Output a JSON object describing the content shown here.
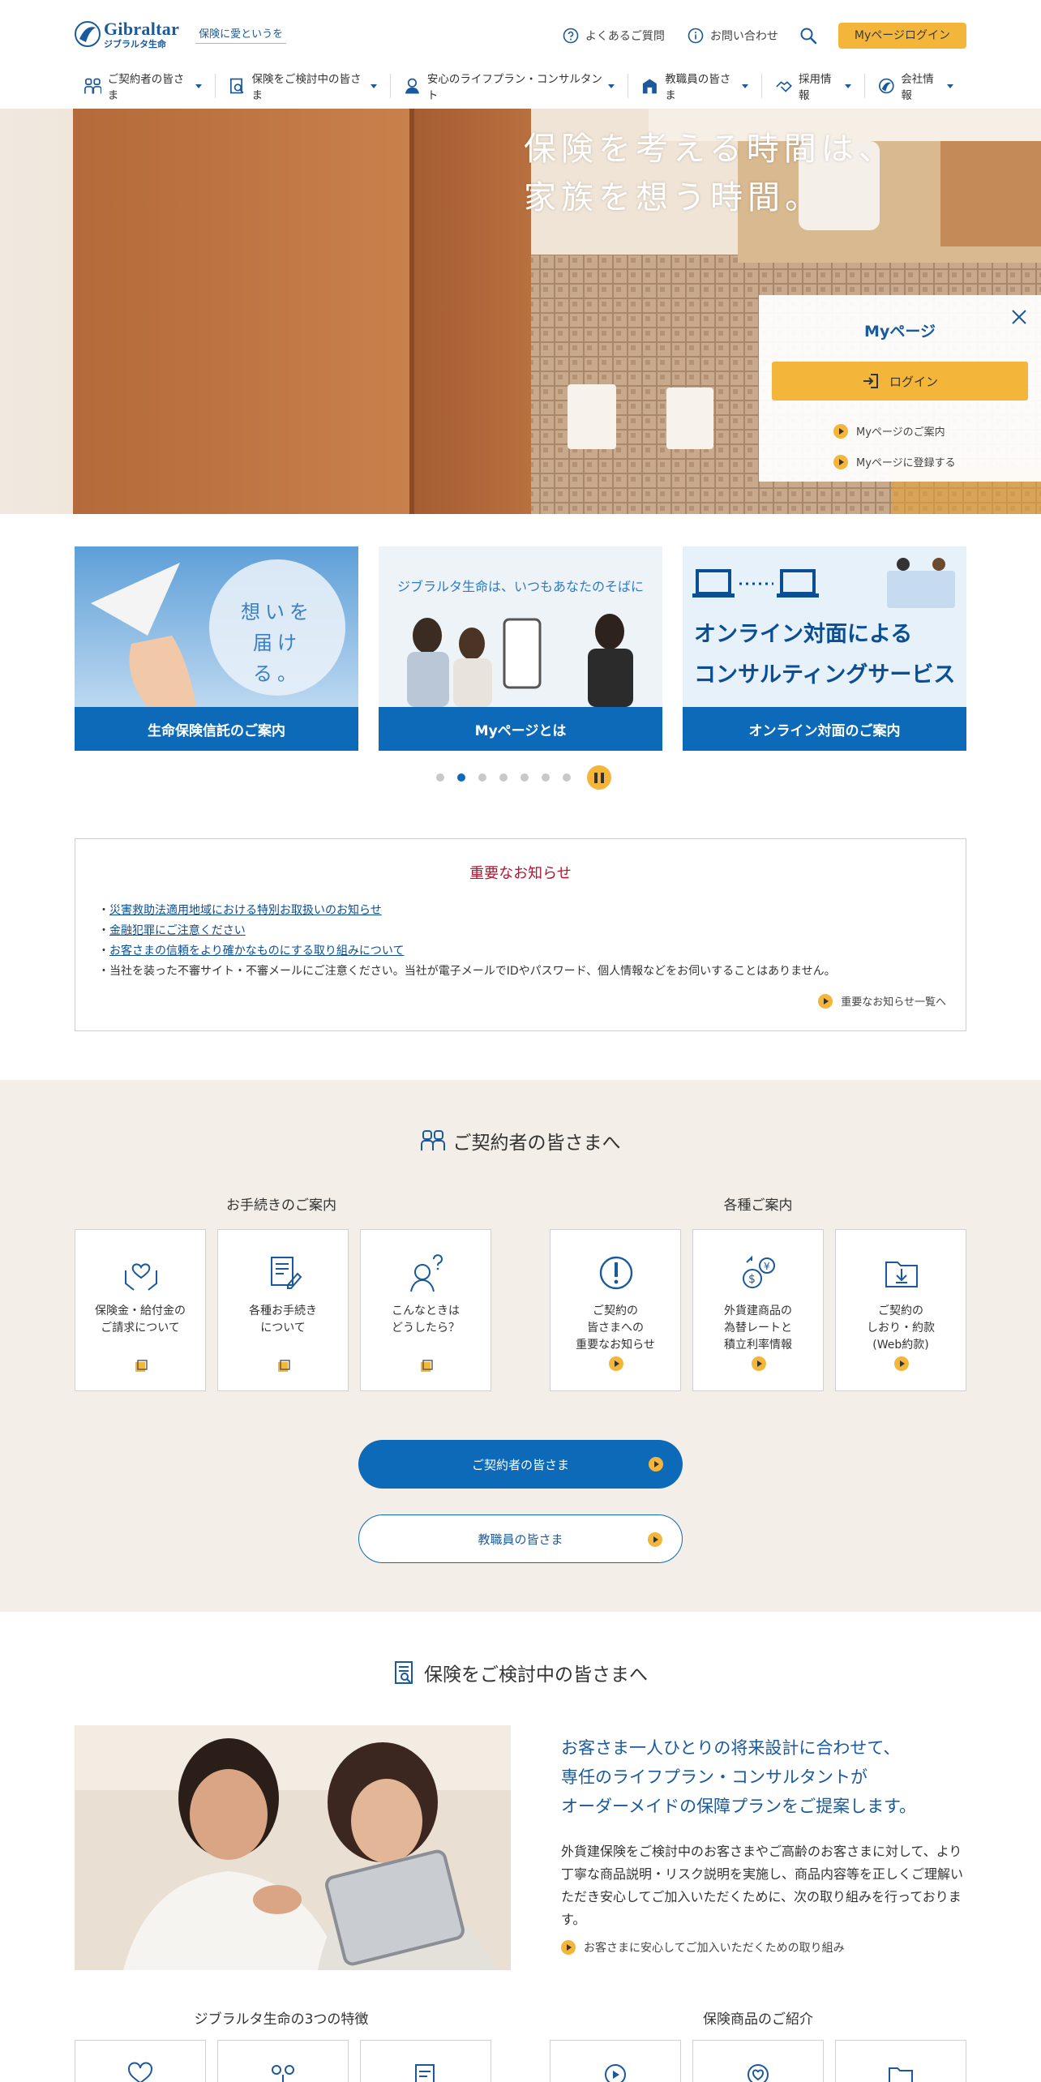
{
  "header": {
    "logo_en": "Gibraltar",
    "logo_jp": "ジブラルタ生命",
    "tagline": "保険に愛というを",
    "faq": "よくあるご質問",
    "contact": "お問い合わせ",
    "mypage_login": "Myページログイン"
  },
  "global_nav": [
    {
      "label": "ご契約者の皆さま",
      "icon": "people-icon"
    },
    {
      "label": "保険をご検討中の皆さま",
      "icon": "document-search-icon"
    },
    {
      "label": "安心のライフプラン・コンサルタント",
      "icon": "consultant-icon"
    },
    {
      "label": "教職員の皆さま",
      "icon": "school-icon"
    },
    {
      "label": "採用情報",
      "icon": "handshake-icon"
    },
    {
      "label": "会社情報",
      "icon": "company-logo-icon"
    }
  ],
  "hero": {
    "line1": "保険を考える時間は、",
    "line2": "家族を想う時間。"
  },
  "mypage_panel": {
    "title": "Myページ",
    "login": "ログイン",
    "guide": "Myページのご案内",
    "register": "Myページに登録する"
  },
  "carousel": {
    "cards": [
      {
        "caption": "生命保険信託のご案内",
        "art_text": "想いを\n届ける。"
      },
      {
        "caption": "Myページとは",
        "art_text": "ジブラルタ生命は、いつもあなたのそばに"
      },
      {
        "caption": "オンライン対面のご案内",
        "art_line1": "オンライン対面による",
        "art_line2": "コンサルティングサービス"
      }
    ],
    "dot_count": 7,
    "active_dot": 1
  },
  "notices": {
    "title": "重要なお知らせ",
    "items": [
      "災害救助法適用地域における特別お取扱いのお知らせ",
      "金融犯罪にご注意ください",
      "お客さまの信頼をより確かなものにする取り組みについて"
    ],
    "plain_item": "当社を装った不審サイト・不審メールにご注意ください。当社が電子メールでIDやパスワード、個人情報などをお伺いすることはありません。",
    "more": "重要なお知らせ一覧へ"
  },
  "contract_section": {
    "title": "ご契約者の皆さまへ",
    "procedures_label": "お手続きのご案内",
    "info_label": "各種ご案内",
    "procedures": [
      {
        "label": "保険金・給付金の\nご請求について",
        "icon": "hands-heart-icon"
      },
      {
        "label": "各種お手続き\nについて",
        "icon": "form-pen-icon"
      },
      {
        "label": "こんなときは\nどうしたら？",
        "icon": "question-person-icon"
      }
    ],
    "info": [
      {
        "label": "ご契約の\n皆さまへの\n重要なお知らせ",
        "icon": "exclamation-icon"
      },
      {
        "label": "外貨建商品の\n為替レートと\n積立利率情報",
        "icon": "currency-exchange-icon"
      },
      {
        "label": "ご契約の\nしおり・約款\n(Web約款)",
        "icon": "download-folder-icon"
      }
    ],
    "btn_contract": "ご契約者の皆さま",
    "btn_teacher": "教職員の皆さま"
  },
  "consider_section": {
    "title": "保険をご検討中の皆さまへ",
    "heading": "お客さま一人ひとりの将来設計に合わせて、\n専任のライフプラン・コンサルタントが\nオーダーメイドの保障プランをご提案します。",
    "body": "外貨建保険をご検討中のお客さまやご高齢のお客さまに対して、より丁寧な商品説明・リスク説明を実施し、商品内容等を正しくご理解いただき安心してご加入いただくために、次の取り組みを行っております。",
    "link": "お客さまに安心してご加入いただくための取り組み",
    "features_label": "ジブラルタ生命の3つの特徴",
    "products_label": "保険商品のご紹介"
  },
  "colors": {
    "brand_blue": "#0c6ab8",
    "accent_yellow": "#f4b63a",
    "notice_red": "#b8122e",
    "beige_bg": "#f3eee7"
  }
}
